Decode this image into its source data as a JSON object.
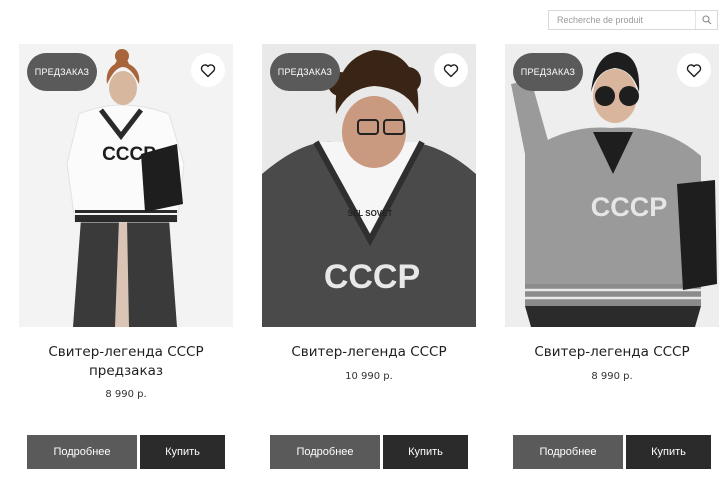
{
  "search": {
    "placeholder": "Recherche de produit",
    "icon": "search-icon"
  },
  "products": [
    {
      "badge": "ПРЕДЗАКАЗ",
      "title": "Свитер-легенда СССР предзаказ",
      "price": "8 990 р.",
      "more_label": "Подробнее",
      "buy_label": "Купить",
      "print": "СССР"
    },
    {
      "badge": "ПРЕДЗАКАЗ",
      "title": "Свитер-легенда СССР",
      "price": "10 990 р.",
      "more_label": "Подробнее",
      "buy_label": "Купить",
      "print": "СССР",
      "tshirt_print": "SEL SOVET"
    },
    {
      "badge": "ПРЕДЗАКАЗ",
      "title": "Свитер-легенда СССР",
      "price": "8 990 р.",
      "more_label": "Подробнее",
      "buy_label": "Купить",
      "print": "СССР"
    }
  ],
  "colors": {
    "more_button": "#5a5a5a",
    "buy_button": "#2b2b2b",
    "badge": "#5a5a5a"
  }
}
